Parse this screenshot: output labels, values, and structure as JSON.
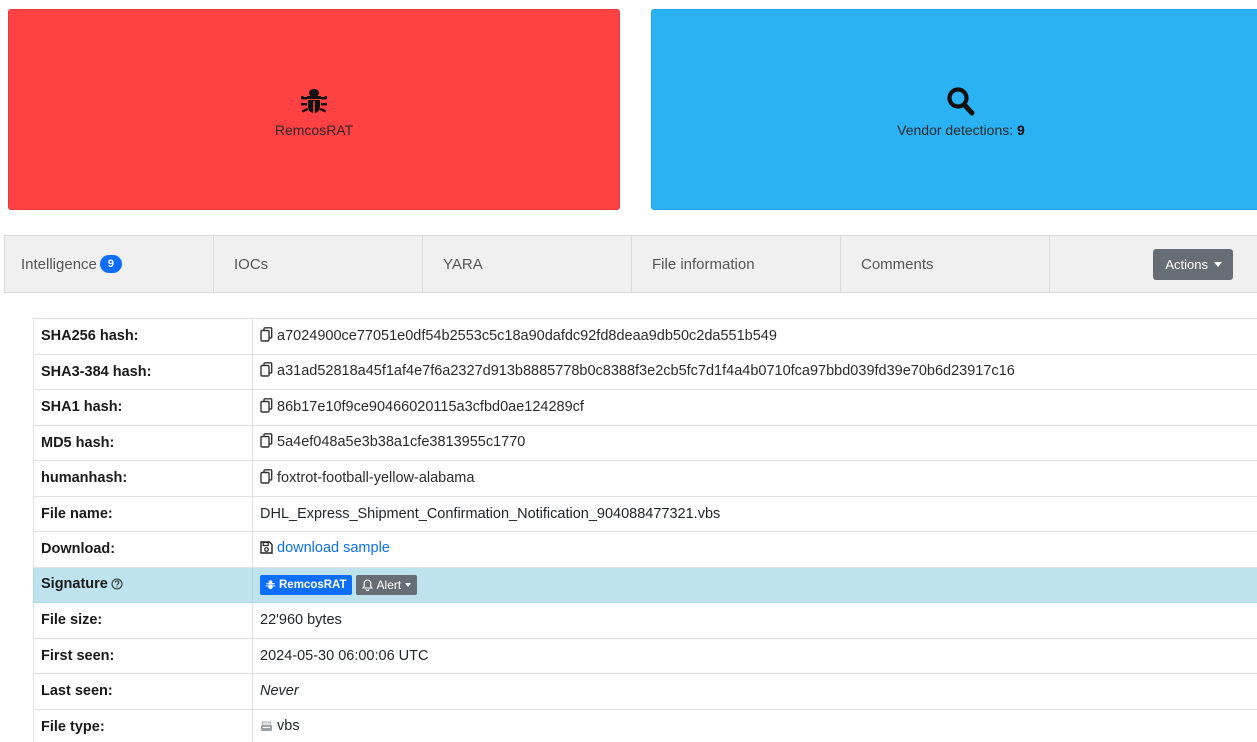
{
  "cards": {
    "malware": {
      "icon": "bug-icon",
      "label": "RemcosRAT",
      "color": "#ff4144"
    },
    "vendor": {
      "icon": "search-icon",
      "label": "Vendor detections: ",
      "count": "9",
      "color": "#2bb2f5"
    }
  },
  "tabs": [
    {
      "label": "Intelligence",
      "badge": "9"
    },
    {
      "label": "IOCs"
    },
    {
      "label": "YARA"
    },
    {
      "label": "File information"
    },
    {
      "label": "Comments"
    }
  ],
  "actions_label": "Actions",
  "rows": {
    "sha256": {
      "key": "SHA256 hash:",
      "value": "a7024900ce77051e0df54b2553c5c18a90dafdc92fd8deaa9db50c2da551b549"
    },
    "sha3": {
      "key": "SHA3-384 hash:",
      "value": "a31ad52818a45f1af4e7f6a2327d913b8885778b0c8388f3e2cb5fc7d1f4a4b0710fca97bbd039fd39e70b6d23917c16"
    },
    "sha1": {
      "key": "SHA1 hash:",
      "value": "86b17e10f9ce90466020115a3cfbd0ae124289cf"
    },
    "md5": {
      "key": "MD5 hash:",
      "value": "5a4ef048a5e3b38a1cfe3813955c1770"
    },
    "humanhash": {
      "key": "humanhash:",
      "value": "foxtrot-football-yellow-alabama"
    },
    "filename": {
      "key": "File name:",
      "value": "DHL_Express_Shipment_Confirmation_Notification_904088477321.vbs"
    },
    "download": {
      "key": "Download:",
      "value": "download sample"
    },
    "signature": {
      "key": "Signature",
      "tag": "RemcosRAT",
      "alert": "Alert"
    },
    "filesize": {
      "key": "File size:",
      "value": "22'960 bytes"
    },
    "firstseen": {
      "key": "First seen:",
      "value": "2024-05-30 06:00:06 UTC"
    },
    "lastseen": {
      "key": "Last seen:",
      "value": "Never"
    },
    "filetype": {
      "key": "File type:",
      "value": "vbs"
    }
  },
  "colors": {
    "accent": "#0d6efd",
    "highlight_row": "#bee3ee",
    "button_gray": "#666d75"
  }
}
